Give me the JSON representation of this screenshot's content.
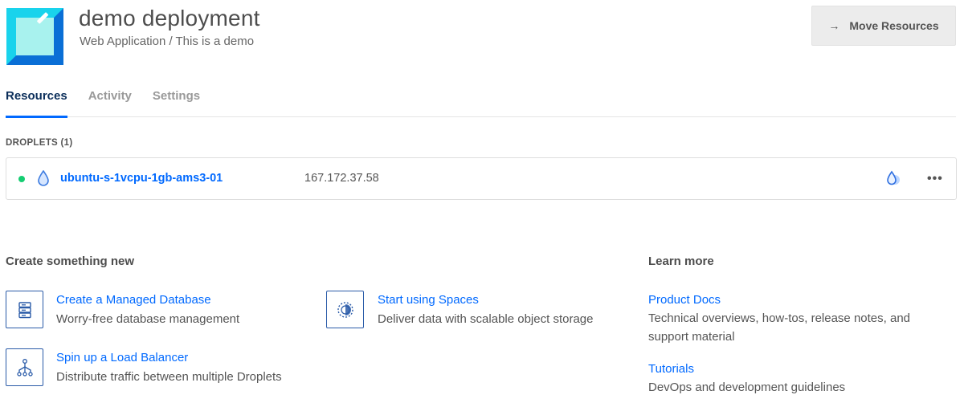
{
  "header": {
    "title": "demo deployment",
    "subtitle": "Web Application / This is a demo",
    "move_button": {
      "arrow": "→",
      "label": "Move Resources"
    },
    "icon_colors": {
      "outer": "#00c8e8",
      "inner": "#a8f2ee",
      "edge": "#0a6fd6"
    }
  },
  "tabs": [
    {
      "label": "Resources",
      "active": true
    },
    {
      "label": "Activity",
      "active": false
    },
    {
      "label": "Settings",
      "active": false
    }
  ],
  "droplets": {
    "section_label": "DROPLETS (1)",
    "items": [
      {
        "status": "active",
        "name": "ubuntu-s-1vcpu-1gb-ams3-01",
        "ip": "167.172.37.58"
      }
    ],
    "more_label": "•••"
  },
  "create": {
    "heading": "Create something new",
    "items": [
      {
        "icon": "database-icon",
        "title": "Create a Managed Database",
        "desc": "Worry-free database management"
      },
      {
        "icon": "spaces-icon",
        "title": "Start using Spaces",
        "desc": "Deliver data with scalable object storage"
      },
      {
        "icon": "load-balancer-icon",
        "title": "Spin up a Load Balancer",
        "desc": "Distribute traffic between multiple Droplets"
      }
    ]
  },
  "learn": {
    "heading": "Learn more",
    "items": [
      {
        "title": "Product Docs",
        "desc": "Technical overviews, how-tos, release notes, and support material"
      },
      {
        "title": "Tutorials",
        "desc": "DevOps and development guidelines"
      }
    ]
  },
  "colors": {
    "accent": "#0069ff",
    "status_green": "#15cd72",
    "icon_border": "#2a5ba8"
  }
}
